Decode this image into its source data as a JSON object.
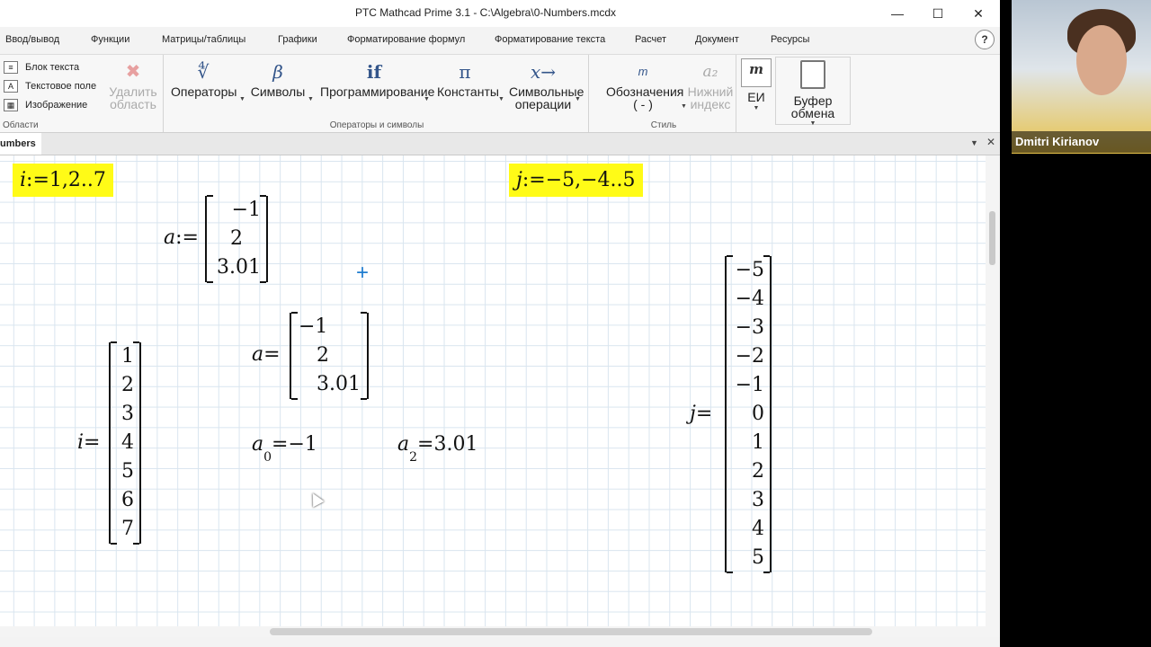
{
  "window": {
    "title": "PTC Mathcad Prime 3.1 - C:\\Algebra\\0-Numbers.mcdx",
    "minimize_glyph": "—",
    "maximize_glyph": "☐",
    "close_glyph": "✕"
  },
  "menu": [
    "Ввод/вывод",
    "Функции",
    "Матрицы/таблицы",
    "Графики",
    "Форматирование формул",
    "Форматирование текста",
    "Расчет",
    "Документ",
    "Ресурсы"
  ],
  "help_label": "?",
  "ribbon": {
    "regions": {
      "items": [
        "Блок текста",
        "Текстовое поле",
        "Изображение"
      ],
      "delete_line1": "Удалить",
      "delete_line2": "область",
      "label": "Области"
    },
    "operators_symbols": {
      "buttons": [
        {
          "glyph": "∜",
          "label": "Операторы",
          "label2": ""
        },
        {
          "glyph": "β",
          "label": "Символы",
          "label2": ""
        },
        {
          "glyph": "if",
          "label": "Программирование",
          "label2": ""
        },
        {
          "glyph": "π",
          "label": "Константы",
          "label2": ""
        },
        {
          "glyph": "x→",
          "label": "Символьные",
          "label2": "операции"
        }
      ],
      "label": "Операторы и символы"
    },
    "style": {
      "notation_label": "Обозначения",
      "notation_value": "( - )",
      "subscript_glyph": "a₂",
      "subscript_line1": "Нижний",
      "subscript_line2": "индекс",
      "label": "Стиль"
    },
    "units": {
      "glyph": "m",
      "label": "ЕИ"
    },
    "clipboard": {
      "label": "Буфер обмена"
    }
  },
  "tab": {
    "name": "umbers"
  },
  "worksheet": {
    "i_def": {
      "var": "i",
      "op": ":=",
      "expr": "1,2..7"
    },
    "j_def": {
      "var": "j",
      "op": ":=",
      "expr": "−5,−4..5"
    },
    "a_def": {
      "var": "a",
      "op": ":=",
      "values": [
        "−1",
        "2",
        "3.01"
      ]
    },
    "a_eval": {
      "var": "a",
      "op": "=",
      "values": [
        "−1",
        "2",
        "3.01"
      ]
    },
    "i_eval": {
      "var": "i",
      "op": "=",
      "values": [
        "1",
        "2",
        "3",
        "4",
        "5",
        "6",
        "7"
      ]
    },
    "j_eval": {
      "var": "j",
      "op": "=",
      "values": [
        "−5",
        "−4",
        "−3",
        "−2",
        "−1",
        "0",
        "1",
        "2",
        "3",
        "4",
        "5"
      ]
    },
    "a0": {
      "var": "a",
      "sub": "0",
      "op": "=",
      "value": "−1"
    },
    "a2": {
      "var": "a",
      "sub": "2",
      "op": "=",
      "value": "3.01"
    }
  },
  "webcam": {
    "name": "Dmitri Kirianov"
  },
  "colors": {
    "highlight": "#fffb17",
    "grid": "#d9e5ef",
    "icon_blue": "#33558a"
  }
}
